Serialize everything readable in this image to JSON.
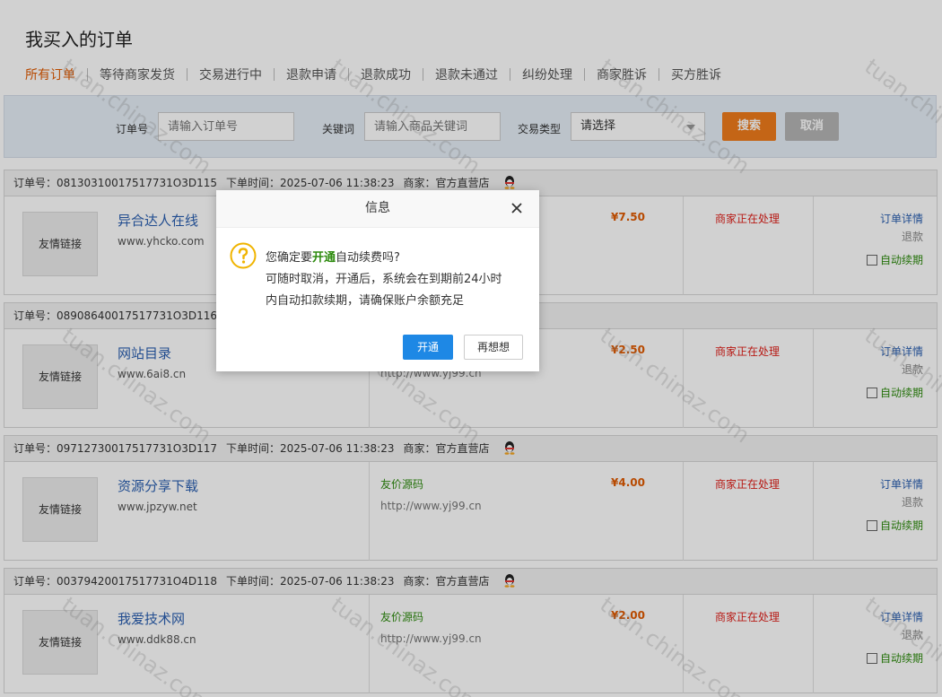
{
  "page_title": "我买入的订单",
  "tabs": [
    "所有订单",
    "等待商家发货",
    "交易进行中",
    "退款申请",
    "退款成功",
    "退款未通过",
    "纠纷处理",
    "商家胜诉",
    "买方胜诉"
  ],
  "active_tab": 0,
  "filter": {
    "order_label": "订单号",
    "order_placeholder": "请输入订单号",
    "keyword_label": "关键词",
    "keyword_placeholder": "请输入商品关键词",
    "type_label": "交易类型",
    "type_value": "请选择",
    "search_button": "搜索",
    "cancel_button": "取消"
  },
  "orders": [
    {
      "order_no": "订单号：08130310017517731O3D115",
      "time": "下单时间：2025-07-06 11:38:23",
      "merchant": "商家：官方直营店",
      "thumb": "友情链接",
      "name": "异合达人在线",
      "url": "www.yhcko.com",
      "category": "",
      "category_url": "",
      "price": "¥7.50",
      "status": "商家正在处理",
      "detail": "订单详情",
      "refund": "退款",
      "renew": "自动续期"
    },
    {
      "order_no": "订单号：08908640017517731O3D116",
      "time": "",
      "merchant": "",
      "thumb": "友情链接",
      "name": "网站目录",
      "url": "www.6ai8.cn",
      "category": "",
      "category_url": "http://www.yj99.cn",
      "price": "¥2.50",
      "status": "商家正在处理",
      "detail": "订单详情",
      "refund": "退款",
      "renew": "自动续期"
    },
    {
      "order_no": "订单号：09712730017517731O3D117",
      "time": "下单时间：2025-07-06 11:38:23",
      "merchant": "商家：官方直营店",
      "thumb": "友情链接",
      "name": "资源分享下载",
      "url": "www.jpzyw.net",
      "category": "友价源码",
      "category_url": "http://www.yj99.cn",
      "price": "¥4.00",
      "status": "商家正在处理",
      "detail": "订单详情",
      "refund": "退款",
      "renew": "自动续期"
    },
    {
      "order_no": "订单号：00379420017517731O4D118",
      "time": "下单时间：2025-07-06 11:38:23",
      "merchant": "商家：官方直营店",
      "thumb": "友情链接",
      "name": "我爱技术网",
      "url": "www.ddk88.cn",
      "category": "友价源码",
      "category_url": "http://www.yj99.cn",
      "price": "¥2.00",
      "status": "商家正在处理",
      "detail": "订单详情",
      "refund": "退款",
      "renew": "自动续期"
    }
  ],
  "dialog": {
    "title": "信息",
    "line1_a": "您确定要",
    "line1_hl": "开通",
    "line1_b": "自动续费吗?",
    "line2": "可随时取消，开通后，系统会在到期前24小时",
    "line3": "内自动扣款续期，请确保账户余额充足",
    "ok": "开通",
    "cancel": "再想想"
  },
  "watermark": "tuan.chinaz.com",
  "colors": {
    "accent": "#f07c1b",
    "link": "#2a5fb0",
    "status": "#e0201a",
    "green": "#2e8b0f",
    "primary": "#1e88e5"
  }
}
